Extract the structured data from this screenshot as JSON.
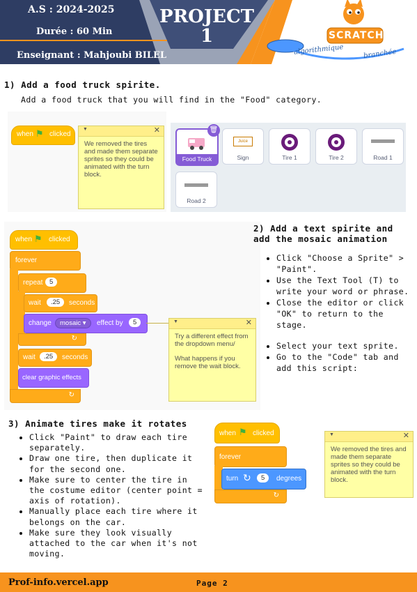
{
  "header": {
    "year_label": "A.S : 2024-2025",
    "duration_label": "Durée :  60 Min",
    "teacher_label": "Enseignant   : Mahjoubi BILEL",
    "project_title": "PROJECT",
    "project_number": "1",
    "logo_text": "SCRATCH",
    "logo_sub1": "algorithmique",
    "logo_sub2": "branchée"
  },
  "section1": {
    "title": "1) Add a food truck spirite.",
    "description": "Add a food truck that you will find in the \"Food\" category."
  },
  "fig1": {
    "hat_when": "when",
    "hat_clicked": "clicked",
    "note_text": "We removed the tires and made them separate sprites so they could be animated with the turn block."
  },
  "sprites": [
    {
      "name": "Food Truck",
      "selected": true
    },
    {
      "name": "Sign"
    },
    {
      "name": "Tire 1"
    },
    {
      "name": "Tire 2"
    },
    {
      "name": "Road 1"
    },
    {
      "name": "Road 2"
    }
  ],
  "sign_text": "Juice",
  "fig2": {
    "when": "when",
    "clicked": "clicked",
    "forever": "forever",
    "repeat": "repeat",
    "repeat_count": "5",
    "wait1": "wait",
    "wait1_value": ".25",
    "seconds1": "seconds",
    "change": "change",
    "effect": "mosaic",
    "effect_by": "effect by",
    "effect_value": "5",
    "wait2": "wait",
    "wait2_value": ".25",
    "seconds2": "seconds",
    "clear": "clear graphic effects",
    "note_line1": "Try a different effect from the dropdown menu/",
    "note_line2": "What happens if you remove the wait block."
  },
  "section2": {
    "title_line1": "2) Add a text spirite and",
    "title_line2": "add the mosaic animation",
    "bullets": [
      "Click \"Choose a Sprite\" > \"Paint\".",
      "Use the Text Tool (T) to write your word or phrase.",
      "Close the editor or click \"OK\" to return to the stage.",
      "Select your text sprite.",
      "Go to the \"Code\" tab and add this script:"
    ]
  },
  "section3": {
    "title": "3) Animate tires make it rotates",
    "bullets": [
      "Click \"Paint\" to draw each tire separately.",
      "Draw one tire, then duplicate it for the second one.",
      "Make sure to center the tire in the costume editor (center point = axis of rotation).",
      "Manually place each tire where it belongs on the car.",
      "Make sure they look visually attached to the car when it's not moving."
    ]
  },
  "fig3": {
    "when": "when",
    "clicked": "clicked",
    "forever": "forever",
    "turn": "turn",
    "turn_value": "5",
    "degrees": "degrees",
    "note_text": "We removed the tires and made them separate sprites so they could be animated with the turn block."
  },
  "footer": {
    "site": "Prof-info.vercel.app",
    "page": "Page 2"
  },
  "colors": {
    "orange": "#f7931e",
    "navy": "#2e3d63",
    "event_yellow": "#ffbf00",
    "control_orange": "#ffab19",
    "looks_purple": "#9966ff",
    "motion_blue": "#4c97ff",
    "note_yellow": "#ffffa5"
  }
}
